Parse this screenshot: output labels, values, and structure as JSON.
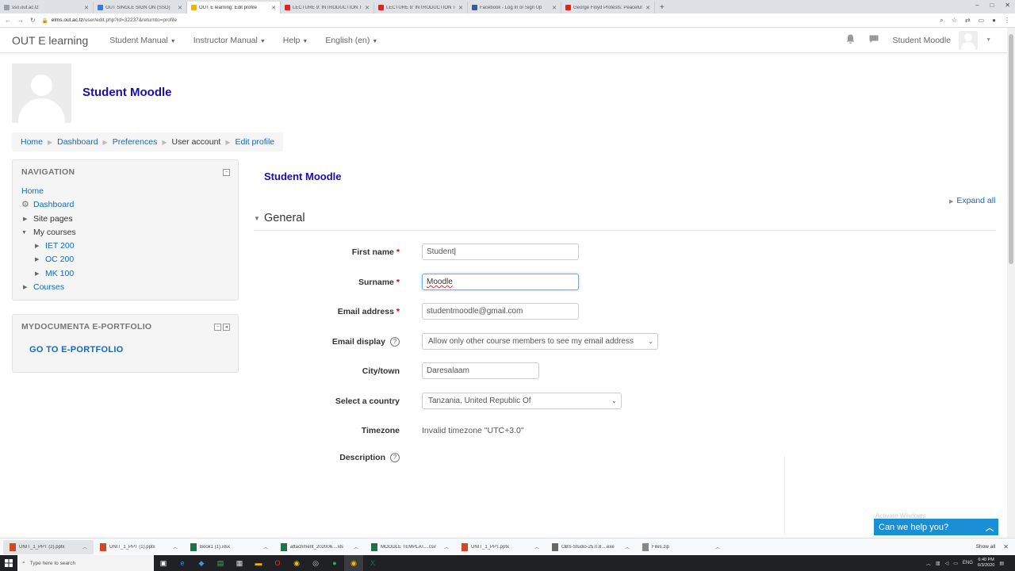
{
  "browser": {
    "tabs": [
      {
        "label": "sso.out.ac.tz",
        "color": "#9aa0a6",
        "active": false
      },
      {
        "label": "OUT SINGLE SIGN ON (SSO)",
        "color": "#3c78d8",
        "active": false
      },
      {
        "label": "OUT E learning: Edit profile",
        "color": "#f4b400",
        "active": true
      },
      {
        "label": "LECTURE 9: INTRODUCTION TO",
        "color": "#e62117",
        "active": false
      },
      {
        "label": "LECTURE 9: INTRODUCTION TO",
        "color": "#e62117",
        "active": false
      },
      {
        "label": "Facebook - Log In or Sign Up",
        "color": "#3b5998",
        "active": false
      },
      {
        "label": "George Floyd Protests: Peaceful",
        "color": "#e62117",
        "active": false
      }
    ],
    "new_tab": "+",
    "window_controls": [
      "–",
      "□",
      "✕"
    ],
    "url_host": "elms.out.ac.tz",
    "url_path": "/user/edit.php?id=32237&returnto=profile"
  },
  "navbar": {
    "brand": "OUT E learning",
    "menus": [
      "Student Manual",
      "Instructor Manual",
      "Help",
      "English (en)"
    ],
    "user_name": "Student Moodle"
  },
  "header": {
    "title": "Student Moodle"
  },
  "breadcrumb": {
    "items": [
      "Home",
      "Dashboard",
      "Preferences",
      "User account",
      "Edit profile"
    ]
  },
  "navigation_block": {
    "title": "NAVIGATION",
    "home": "Home",
    "dashboard": "Dashboard",
    "site_pages": "Site pages",
    "my_courses": "My courses",
    "courses_list": [
      "IET 200",
      "OC 200",
      "MK 100"
    ],
    "courses": "Courses"
  },
  "portfolio_block": {
    "title": "MYDOCUMENTA E-PORTFOLIO",
    "link": "GO TO E-PORTFOLIO"
  },
  "main": {
    "title": "Student Moodle",
    "expand_all": "Expand all",
    "section": "General"
  },
  "form": {
    "first_name_label": "First name",
    "first_name_value": "Student",
    "surname_label": "Surname",
    "surname_value": "Moodle",
    "email_label": "Email address",
    "email_value": "studentmoodle@gmail.com",
    "email_display_label": "Email display",
    "email_display_value": "Allow only other course members to see my email address",
    "city_label": "City/town",
    "city_value": "Daresalaam",
    "country_label": "Select a country",
    "country_value": "Tanzania, United Republic Of",
    "timezone_label": "Timezone",
    "timezone_value": "Invalid timezone \"UTC+3.0\"",
    "description_label": "Description"
  },
  "chat": {
    "label": "Can we help you?"
  },
  "watermark": "Activate Windows",
  "downloads": {
    "items": [
      "UNIT_1_PPT (2).pptx",
      "UNIT_1_PPT (1).pptx",
      "Book1 (1).xlsx",
      "attachment_202006....xls",
      "MOODLE TEMPLAT....csv",
      "UNIT_1_PPT.pptx",
      "OBS-Studio-25.0.8....exe",
      "Files.zip"
    ],
    "show_all": "Show all"
  },
  "taskbar": {
    "search_placeholder": "Type here to search",
    "lang": "ENG",
    "time": "6:40 PM",
    "date": "6/3/2020"
  }
}
